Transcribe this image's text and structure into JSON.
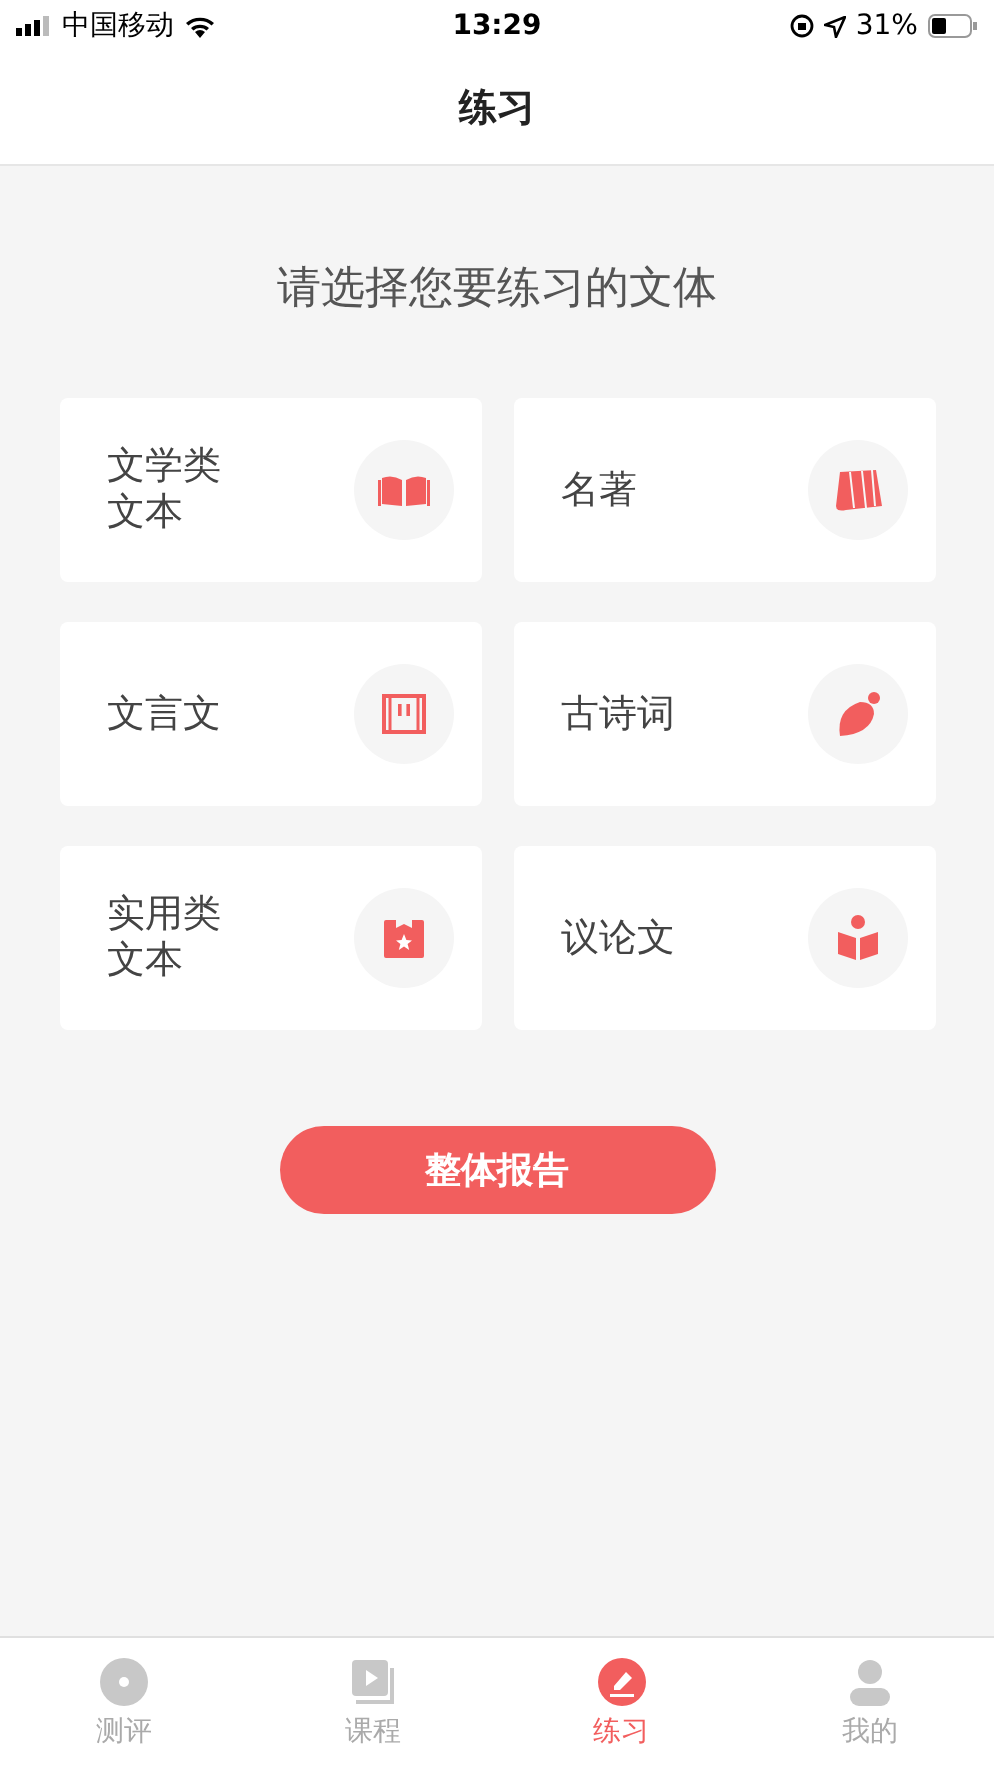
{
  "status_bar": {
    "carrier": "中国移动",
    "time": "13:29",
    "battery": "31%"
  },
  "nav": {
    "title": "练习"
  },
  "prompt": "请选择您要练习的文体",
  "cards": [
    {
      "label": "文学类文本",
      "kind": "book"
    },
    {
      "label": "名著",
      "kind": "map"
    },
    {
      "label": "文言文",
      "kind": "scroll"
    },
    {
      "label": "古诗词",
      "kind": "leaf"
    },
    {
      "label": "实用类文本",
      "kind": "badge"
    },
    {
      "label": "议论文",
      "kind": "reader"
    }
  ],
  "report_button": "整体报告",
  "tabs": [
    {
      "label": "测评",
      "kind": "disc",
      "selected": false
    },
    {
      "label": "课程",
      "kind": "video",
      "selected": false
    },
    {
      "label": "练习",
      "kind": "pencil",
      "selected": true
    },
    {
      "label": "我的",
      "kind": "person",
      "selected": false
    }
  ]
}
